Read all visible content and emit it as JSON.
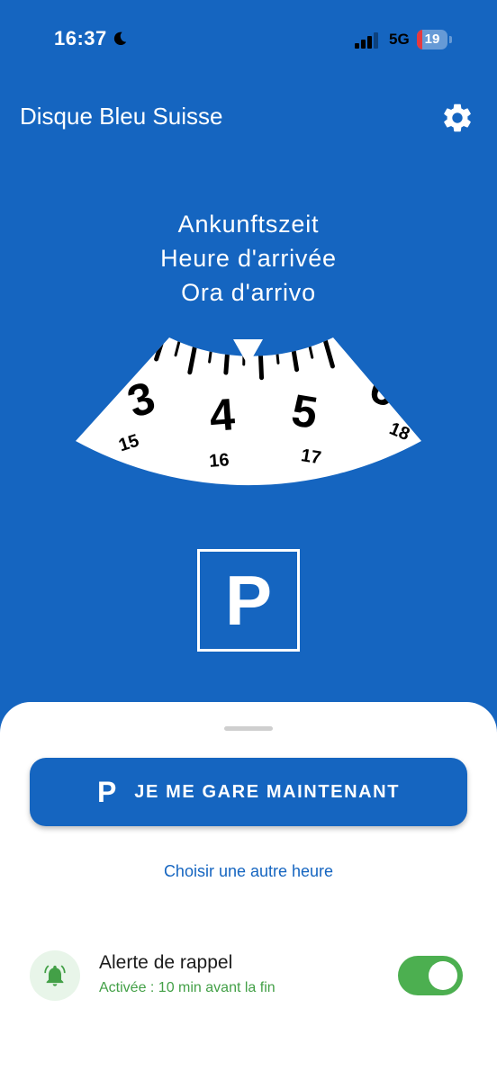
{
  "status_bar": {
    "time": "16:37",
    "network": "5G",
    "battery_percent": "19",
    "battery_level": 0.19,
    "icons": [
      "moon-icon",
      "signal-icon",
      "battery-icon"
    ]
  },
  "app": {
    "title": "Disque Bleu Suisse",
    "settings_icon": "gear-icon"
  },
  "arrival": {
    "de": "Ankunftszeit",
    "fr": "Heure d'arrivée",
    "it": "Ora d'arrivo"
  },
  "dial": {
    "major_labels": [
      "3",
      "4",
      "5",
      "6"
    ],
    "minor_labels": [
      "15",
      "16",
      "17",
      "18"
    ],
    "pointer_icon": "triangle-down-icon"
  },
  "parking_sign": {
    "letter": "P"
  },
  "sheet": {
    "park_button": {
      "icon": "P",
      "label": "JE ME GARE MAINTENANT"
    },
    "other_time_link": "Choisir une autre heure",
    "alert": {
      "title": "Alerte de rappel",
      "subtitle": "Activée : 10 min avant la fin",
      "enabled": true,
      "icon": "bell-icon"
    }
  },
  "colors": {
    "primary": "#1565c0",
    "accent_green": "#4caf50",
    "battery_low": "#e5393f",
    "white": "#ffffff"
  }
}
